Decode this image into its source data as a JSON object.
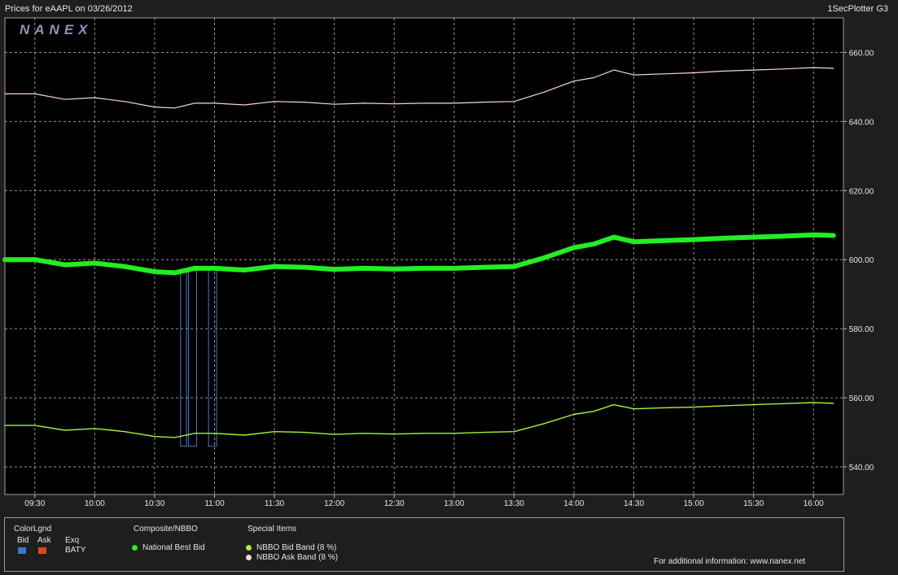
{
  "header": {
    "title": "Prices for  eAAPL  on  03/26/2012",
    "app_name": "1SecPlotter G3"
  },
  "watermark": "NANEX",
  "legend": {
    "color_legend_title": "ColorLgnd",
    "bid_label": "Bid",
    "ask_label": "Ask",
    "exq_label": "Exq",
    "exchange": "BATY",
    "composite_title": "Composite/NBBO",
    "composite_item": "National Best Bid",
    "special_title": "Special Items",
    "special_items": [
      "NBBO Bid Band (8 %)",
      "NBBO Ask Band (8 %)"
    ],
    "footer": "For additional information: www.nanex.net"
  },
  "colors": {
    "bid_square": "#3a78c9",
    "ask_square": "#d24a1e",
    "national_best_bid": "#22ee22",
    "bid_band": "#a6f23c",
    "ask_band": "#ffd6d6",
    "exchange_bid_lines": "#4f76c4"
  },
  "chart_data": {
    "type": "line",
    "x_tick_labels": [
      "09:30",
      "10:00",
      "10:30",
      "11:00",
      "11:30",
      "12:00",
      "12:30",
      "13:00",
      "13:30",
      "14:00",
      "14:30",
      "15:00",
      "15:30",
      "16:00"
    ],
    "xlim": [
      "09:15",
      "16:15"
    ],
    "ylim": [
      532,
      670
    ],
    "y_ticks": [
      540,
      560,
      580,
      600,
      620,
      640,
      660
    ],
    "y_tick_labels": [
      "540.00",
      "560.00",
      "580.00",
      "600.00",
      "620.00",
      "640.00",
      "660.00"
    ],
    "grid": true,
    "series": [
      {
        "name": "National Best Bid",
        "x": [
          "09:15",
          "09:30",
          "09:45",
          "10:00",
          "10:15",
          "10:30",
          "10:40",
          "10:50",
          "11:00",
          "11:15",
          "11:30",
          "11:45",
          "12:00",
          "12:15",
          "12:30",
          "12:45",
          "13:00",
          "13:15",
          "13:30",
          "13:45",
          "14:00",
          "14:10",
          "14:20",
          "14:30",
          "14:45",
          "15:00",
          "15:15",
          "15:30",
          "15:45",
          "16:00",
          "16:10"
        ],
        "values": [
          600.0,
          600.0,
          598.5,
          599.0,
          598.0,
          596.5,
          596.2,
          597.5,
          597.5,
          597.0,
          598.0,
          597.8,
          597.2,
          597.5,
          597.3,
          597.5,
          597.5,
          597.8,
          598.0,
          600.5,
          603.5,
          604.5,
          606.5,
          605.2,
          605.5,
          605.8,
          606.2,
          606.5,
          606.8,
          607.2,
          607.0
        ]
      },
      {
        "name": "NBBO Bid Band (8 %)",
        "x": [
          "09:15",
          "09:30",
          "09:45",
          "10:00",
          "10:15",
          "10:30",
          "10:40",
          "10:50",
          "11:00",
          "11:15",
          "11:30",
          "11:45",
          "12:00",
          "12:15",
          "12:30",
          "12:45",
          "13:00",
          "13:15",
          "13:30",
          "13:45",
          "14:00",
          "14:10",
          "14:20",
          "14:30",
          "14:45",
          "15:00",
          "15:15",
          "15:30",
          "15:45",
          "16:00",
          "16:10"
        ],
        "values": [
          552.0,
          552.0,
          550.6,
          551.1,
          550.2,
          548.8,
          548.5,
          549.7,
          549.7,
          549.2,
          550.2,
          550.0,
          549.4,
          549.7,
          549.5,
          549.7,
          549.7,
          550.0,
          550.2,
          552.5,
          555.2,
          556.1,
          558.0,
          556.8,
          557.1,
          557.3,
          557.7,
          558.0,
          558.3,
          558.6,
          558.4
        ]
      },
      {
        "name": "NBBO Ask Band (8 %)",
        "x": [
          "09:15",
          "09:30",
          "09:45",
          "10:00",
          "10:15",
          "10:30",
          "10:40",
          "10:50",
          "11:00",
          "11:15",
          "11:30",
          "11:45",
          "12:00",
          "12:15",
          "12:30",
          "12:45",
          "13:00",
          "13:15",
          "13:30",
          "13:45",
          "14:00",
          "14:10",
          "14:20",
          "14:30",
          "14:45",
          "15:00",
          "15:15",
          "15:30",
          "15:45",
          "16:00",
          "16:10"
        ],
        "values": [
          648.0,
          648.0,
          646.4,
          646.9,
          645.8,
          644.2,
          643.9,
          645.3,
          645.3,
          644.8,
          645.8,
          645.6,
          645.0,
          645.3,
          645.1,
          645.3,
          645.3,
          645.6,
          645.8,
          648.5,
          651.7,
          652.7,
          654.9,
          653.5,
          653.8,
          654.1,
          654.6,
          654.9,
          655.2,
          655.6,
          655.4
        ]
      }
    ],
    "exchange_bid_drops": [
      {
        "x_start": "10:43",
        "x_end": "10:46",
        "top": 596.5,
        "bottom": 546.0
      },
      {
        "x_start": "10:47",
        "x_end": "10:51",
        "top": 596.8,
        "bottom": 546.0
      },
      {
        "x_start": "10:57",
        "x_end": "11:01",
        "top": 597.3,
        "bottom": 546.0
      }
    ]
  }
}
